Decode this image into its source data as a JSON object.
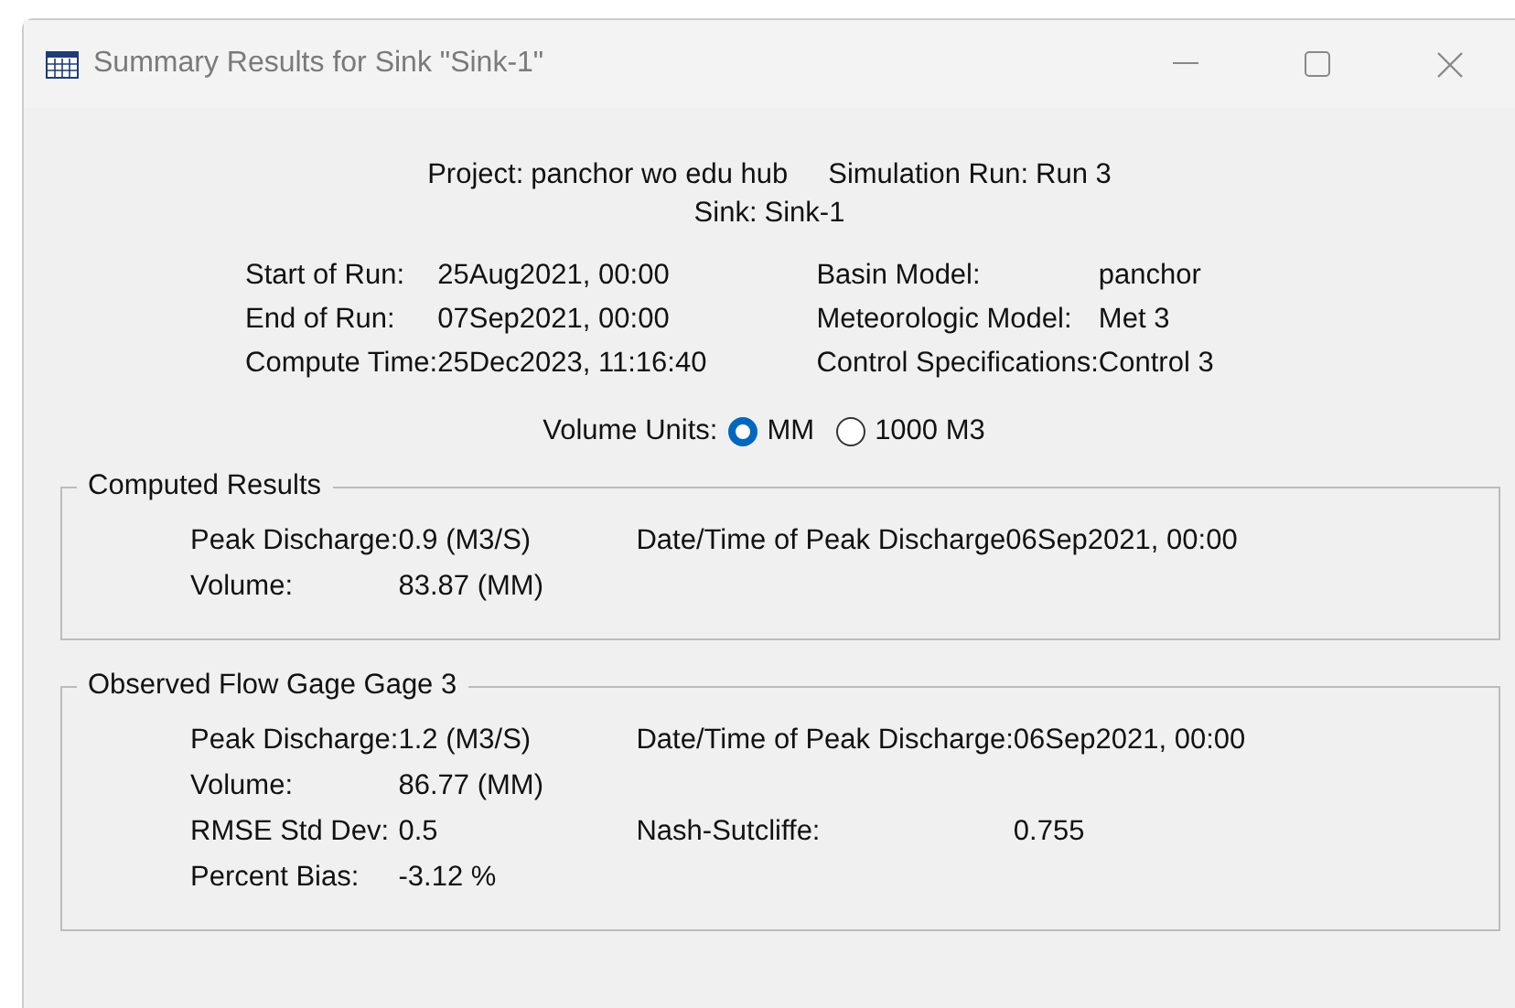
{
  "window": {
    "title": "Summary Results for Sink \"Sink-1\""
  },
  "header": {
    "items": [
      {
        "label": "Project:",
        "value": "panchor wo edu hub"
      },
      {
        "label": "Simulation Run:",
        "value": "Run 3"
      }
    ],
    "sink": {
      "label": "Sink:",
      "value": "Sink-1"
    }
  },
  "run_info": {
    "left": [
      {
        "label": "Start of Run:",
        "value": "25Aug2021, 00:00"
      },
      {
        "label": "End of Run:",
        "value": "07Sep2021, 00:00"
      },
      {
        "label": "Compute Time:",
        "value": "25Dec2023, 11:16:40"
      }
    ],
    "right": [
      {
        "label": "Basin Model:",
        "value": "panchor"
      },
      {
        "label": "Meteorologic Model:",
        "value": "Met 3"
      },
      {
        "label": "Control Specifications:",
        "value": "Control 3"
      }
    ]
  },
  "volume_units": {
    "label": "Volume Units:",
    "options": [
      {
        "label": "MM",
        "selected": true
      },
      {
        "label": "1000 M3",
        "selected": false
      }
    ]
  },
  "groups": [
    {
      "title": "Computed Results",
      "rows": [
        {
          "left": {
            "label": "Peak Discharge:",
            "value": "0.9 (M3/S)"
          },
          "right": {
            "label": "Date/Time of Peak Discharge",
            "value": "06Sep2021, 00:00"
          }
        },
        {
          "left": {
            "label": "Volume:",
            "value": "83.87 (MM)"
          }
        }
      ]
    },
    {
      "title": "Observed Flow Gage Gage 3",
      "rows": [
        {
          "left": {
            "label": "Peak Discharge:",
            "value": "1.2 (M3/S)"
          },
          "right": {
            "label": "Date/Time of Peak Discharge:",
            "value": "06Sep2021, 00:00"
          }
        },
        {
          "left": {
            "label": "Volume:",
            "value": "86.77 (MM)"
          }
        },
        {
          "left": {
            "label": "RMSE Std Dev:",
            "value": "0.5"
          },
          "right": {
            "label": "Nash-Sutcliffe:",
            "value": "0.755"
          }
        },
        {
          "left": {
            "label": "Percent Bias:",
            "value": "-3.12 %"
          }
        }
      ]
    }
  ]
}
